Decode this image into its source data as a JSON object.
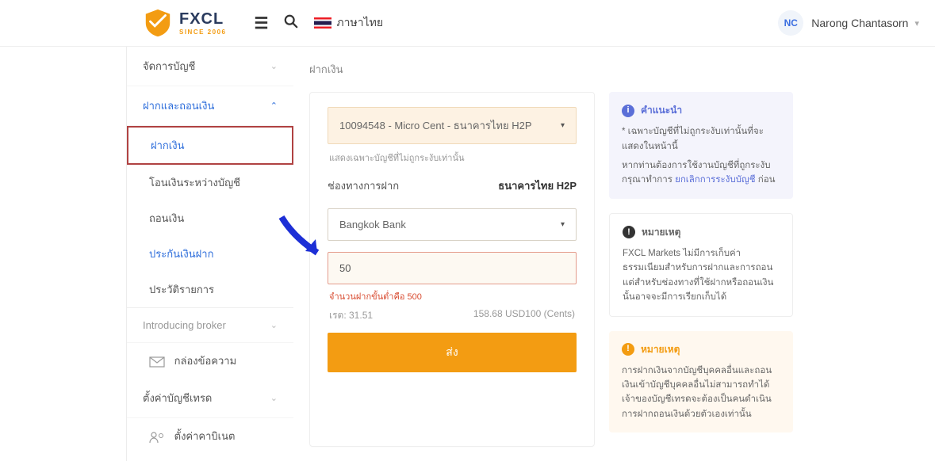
{
  "header": {
    "logo_main": "FXCL",
    "logo_sub": "SINCE 2006",
    "language": "ภาษาไทย",
    "user_initials": "NC",
    "user_name": "Narong Chantasorn"
  },
  "sidebar": {
    "manage": "จัดการบัญชี",
    "deposit_withdraw": "ฝากและถอนเงิน",
    "deposit": "ฝากเงิน",
    "transfer": "โอนเงินระหว่างบัญชี",
    "withdraw": "ถอนเงิน",
    "insure": "ประกันเงินฝาก",
    "history": "ประวัติรายการ",
    "ib": "Introducing broker",
    "inbox": "กล่องข้อความ",
    "settings": "ตั้งค่าบัญชีเทรด",
    "cabinet": "ตั้งค่าคาบิเนต"
  },
  "main": {
    "title": "ฝากเงิน",
    "account_select": "10094548 - Micro Cent - ธนาคารไทย H2P",
    "account_note": "แสดงเฉพาะบัญชีที่ไม่ถูกระงับเท่านั้น",
    "channel_label": "ช่องทางการฝาก",
    "channel_value": "ธนาคารไทย H2P",
    "bank_select": "Bangkok Bank",
    "amount_value": "50",
    "error_text": "จำนวนฝากขั้นต่ำคือ 500",
    "rate_label": "เรต: 31.51",
    "rate_conv": "158.68 USD100 (Cents)",
    "submit": "ส่ง"
  },
  "info1": {
    "title": "คำแนะนำ",
    "line1": "* เฉพาะบัญชีที่ไม่ถูกระงับเท่านั้นที่จะแสดงในหน้านี้",
    "line2a": "หากท่านต้องการใช้งานบัญชีที่ถูกระงับ กรุณาทำการ ",
    "link": "ยกเลิกการระงับบัญชี",
    "line2b": " ก่อน"
  },
  "info2": {
    "title": "หมายเหตุ",
    "body": "FXCL Markets ไม่มีการเก็บค่าธรรมเนียมสำหรับการฝากและการถอน แต่สำหรับช่องทางที่ใช้ฝากหรือถอนเงินนั้นอาจจะมีการเรียกเก็บได้"
  },
  "info3": {
    "title": "หมายเหตุ",
    "body": "การฝากเงินจากบัญชีบุคคลอื่นและถอนเงินเข้าบัญชีบุคคลอื่นไม่สามารถทำได้ เจ้าของบัญชีเทรดจะต้องเป็นคนดำเนินการฝากถอนเงินด้วยตัวเองเท่านั้น"
  }
}
